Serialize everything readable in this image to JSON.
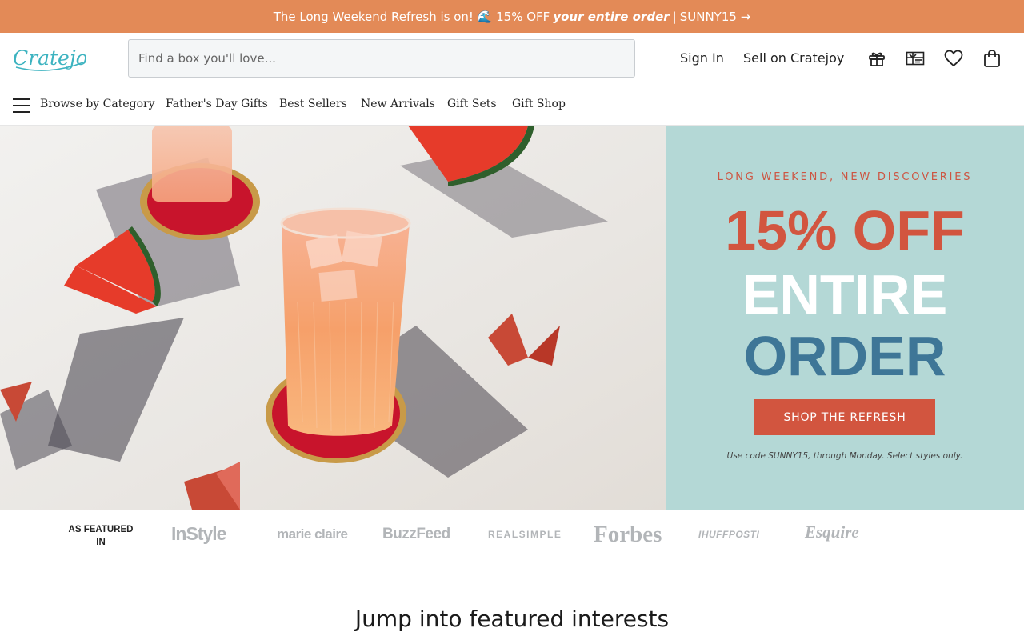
{
  "promo": {
    "lead": "The Long Weekend Refresh is on! 🌊 15% OFF",
    "emphasis": "your entire order",
    "separator": "|",
    "code_link": "SUNNY15 →",
    "background": "#e38a57"
  },
  "header": {
    "logo_text": "Cratejoy",
    "search_placeholder": "Find a box you'll love...",
    "search_value": "",
    "links": [
      "Sign In",
      "Sell on Cratejoy"
    ],
    "icons": [
      "gift-icon",
      "gift-card-icon",
      "heart-icon",
      "shopping-bag-icon"
    ]
  },
  "nav": {
    "menu_icon": "hamburger-menu-icon",
    "items": [
      "Browse by Category",
      "Father's Day Gifts",
      "Best Sellers",
      "New Arrivals",
      "Gift Sets",
      "Gift Shop"
    ]
  },
  "hero": {
    "eyebrow": "LONG WEEKEND, NEW DISCOVERIES",
    "line1": "15% OFF",
    "line2": "ENTIRE",
    "line3": "ORDER",
    "cta": "SHOP THE REFRESH",
    "fine_print": "Use code SUNNY15, through Monday. Select styles only.",
    "panel_color": "#b4d8d6",
    "accent_color": "#d2553f",
    "blue_color": "#3e7697"
  },
  "featured": {
    "label": "AS FEATURED IN",
    "brands": [
      "InStyle",
      "marie claire",
      "BuzzFeed",
      "REALSIMPLE",
      "Forbes",
      "IHUFFPOSTI",
      "Esquire"
    ]
  },
  "section": {
    "title": "Jump into featured interests"
  }
}
